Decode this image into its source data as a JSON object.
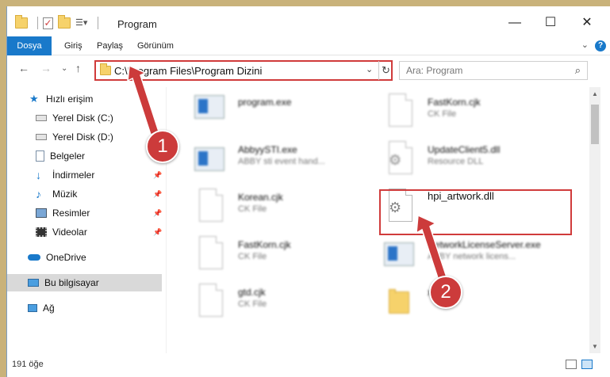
{
  "window": {
    "title": "Program",
    "minimize": "—",
    "maximize": "☐",
    "close": "✕"
  },
  "ribbon": {
    "file_tab": "Dosya",
    "tabs": [
      "Giriş",
      "Paylaş",
      "Görünüm"
    ],
    "help": "?"
  },
  "nav": {
    "address": "C:\\Program Files\\Program Dizini",
    "search_placeholder": "Ara: Program"
  },
  "sidebar": {
    "items": [
      {
        "label": "Hızlı erişim",
        "icon": "star-icon"
      },
      {
        "label": "Yerel Disk (C:)",
        "icon": "drive-icon"
      },
      {
        "label": "Yerel Disk (D:)",
        "icon": "drive-icon"
      },
      {
        "label": "Belgeler",
        "icon": "document-icon"
      },
      {
        "label": "İndirmeler",
        "icon": "download-icon"
      },
      {
        "label": "Müzik",
        "icon": "music-icon"
      },
      {
        "label": "Resimler",
        "icon": "pictures-icon"
      },
      {
        "label": "Videolar",
        "icon": "video-icon"
      },
      {
        "label": "OneDrive",
        "icon": "cloud-icon"
      },
      {
        "label": "Bu bilgisayar",
        "icon": "computer-icon"
      },
      {
        "label": "Ağ",
        "icon": "network-icon"
      }
    ]
  },
  "files": [
    {
      "name": "program.exe",
      "type": ""
    },
    {
      "name": "FastKorn.cjk",
      "type": "CK File"
    },
    {
      "name": "AbbyySTI.exe",
      "type": "ABBY sti event hand..."
    },
    {
      "name": "UpdateClient5.dll",
      "type": "Resource DLL"
    },
    {
      "name": "Korean.cjk",
      "type": "CK File"
    },
    {
      "name": "hpi_artwork.dll",
      "type": ""
    },
    {
      "name": "FastKorn.cjk",
      "type": "CK File"
    },
    {
      "name": "NetworkLicenseServer.exe",
      "type": "ABBY network licens..."
    },
    {
      "name": "gtd.cjk",
      "type": "CK File"
    },
    {
      "name": "xls",
      "type": ""
    }
  ],
  "status": {
    "count": "191 öğe"
  },
  "callouts": [
    "1",
    "2"
  ],
  "colors": {
    "accent": "#1979ca",
    "highlight": "#d03b3b"
  }
}
